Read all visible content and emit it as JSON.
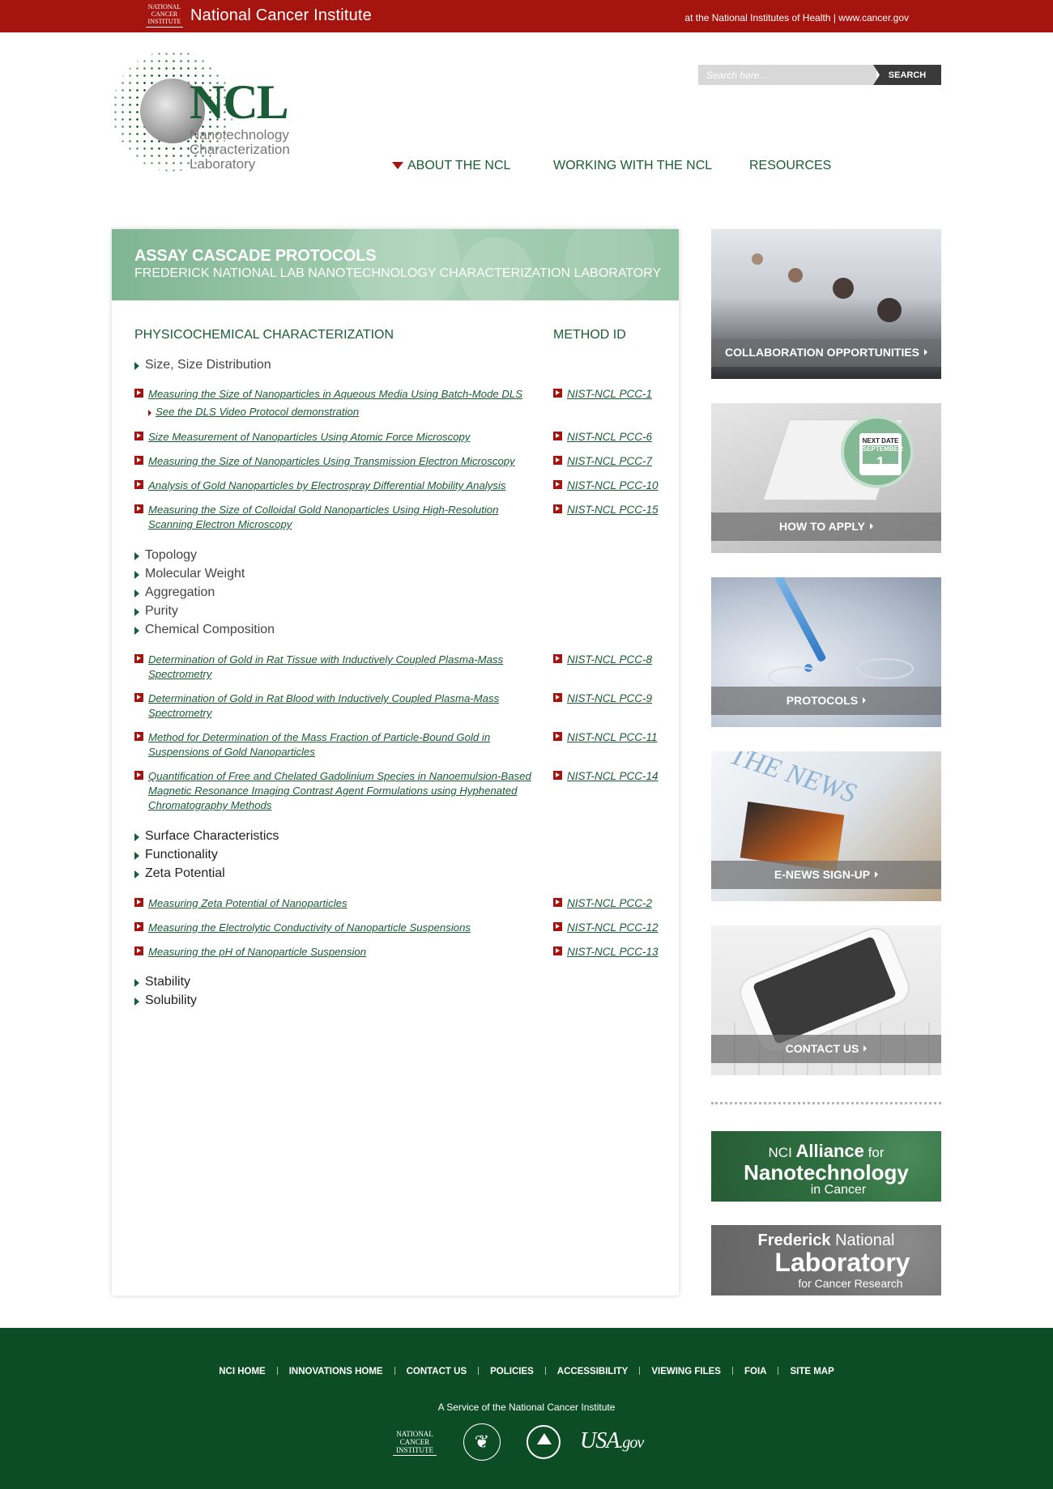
{
  "topbar": {
    "nci_logo": "NATIONAL CANCER INSTITUTE",
    "title": "National Cancer Institute",
    "right_text": "at the National Institutes of Health | www.cancer.gov"
  },
  "header": {
    "logo_big": "NCL",
    "logo_sub": [
      "Nanotechnology",
      "Characterization",
      "Laboratory"
    ],
    "search": {
      "placeholder": "Search here...",
      "value": "",
      "button": "SEARCH"
    },
    "nav": [
      "ABOUT THE NCL",
      "WORKING WITH THE NCL",
      "RESOURCES"
    ]
  },
  "banner": {
    "title": "ASSAY CASCADE PROTOCOLS",
    "subtitle": "FREDERICK NATIONAL LAB NANOTECHNOLOGY CHARACTERIZATION LABORATORY"
  },
  "table": {
    "col1": "PHYSICOCHEMICAL CHARACTERIZATION",
    "col2": "METHOD ID",
    "categories": [
      "Size, Size Distribution",
      "Topology",
      "Molecular Weight",
      "Aggregation",
      "Purity",
      "Chemical Composition",
      "Surface Characteristics",
      "Functionality",
      "Zeta Potential",
      "Stability",
      "Solubility"
    ],
    "protocols": [
      {
        "title": "Measuring the Size of Nanoparticles in Aqueous Media Using Batch-Mode DLS",
        "id": "NIST-NCL PCC-1"
      },
      {
        "title": "Size Measurement of Nanoparticles Using Atomic Force Microscopy",
        "id": "NIST-NCL PCC-6"
      },
      {
        "title": "Measuring the Size of Nanoparticles Using Transmission Electron Microscopy",
        "id": "NIST-NCL PCC-7"
      },
      {
        "title": "Analysis of Gold Nanoparticles by Electrospray Differential Mobility Analysis",
        "id": "NIST-NCL PCC-10"
      },
      {
        "title": "Measuring the Size of Colloidal Gold Nanoparticles Using High-Resolution Scanning Electron Microscopy",
        "id": "NIST-NCL PCC-15"
      },
      {
        "title": "Determination of Gold in Rat Tissue with Inductively Coupled Plasma-Mass Spectrometry",
        "id": "NIST-NCL PCC-8"
      },
      {
        "title": "Determination of Gold in Rat Blood with Inductively Coupled Plasma-Mass Spectrometry",
        "id": "NIST-NCL PCC-9"
      },
      {
        "title": "Method for Determination of the Mass Fraction of Particle-Bound Gold in Suspensions of Gold Nanoparticles",
        "id": "NIST-NCL PCC-11"
      },
      {
        "title": "Quantification of Free and Chelated Gadolinium Species in Nanoemulsion-Based Magnetic Resonance Imaging Contrast Agent Formulations using Hyphenated Chromatography Methods",
        "id": "NIST-NCL PCC-14"
      },
      {
        "title": "Measuring Zeta Potential of Nanoparticles",
        "id": "NIST-NCL PCC-2"
      },
      {
        "title": "Measuring the Electrolytic Conductivity of Nanoparticle Suspensions",
        "id": "NIST-NCL PCC-12"
      },
      {
        "title": "Measuring the pH of Nanoparticle Suspension",
        "id": "NIST-NCL PCC-13"
      }
    ],
    "dls_video": "See the DLS Video Protocol demonstration"
  },
  "sidebar": {
    "cards": [
      "COLLABORATION OPPORTUNITIES",
      "HOW TO APPLY",
      "PROTOCOLS",
      "E-NEWS SIGN-UP",
      "CONTACT US"
    ],
    "next_date": {
      "label": "NEXT DATE",
      "month": "SEPTEMBER",
      "day": "1"
    },
    "news_text": "THE NEWS",
    "alliance": {
      "l1": "NCI",
      "l1b": "Alliance",
      "l1c": "for",
      "l2": "Nanotechnology",
      "l3": "in Cancer"
    },
    "frederick": {
      "l1": "Frederick",
      "l1b": "National",
      "l2": "Laboratory",
      "l3": "for Cancer Research"
    }
  },
  "footer": {
    "links": [
      "NCI HOME",
      "INNOVATIONS HOME",
      "CONTACT US",
      "POLICIES",
      "ACCESSIBILITY",
      "VIEWING FILES",
      "FOIA",
      "SITE MAP"
    ],
    "service": "A Service of the National Cancer Institute",
    "logo_nci": "NATIONAL CANCER INSTITUTE",
    "logo_usa": "USA",
    "logo_usa_gov": ".gov"
  },
  "colors": {
    "brand_red": "#a5140e",
    "brand_green": "#1a5c36",
    "footer_green": "#0d4d26"
  }
}
